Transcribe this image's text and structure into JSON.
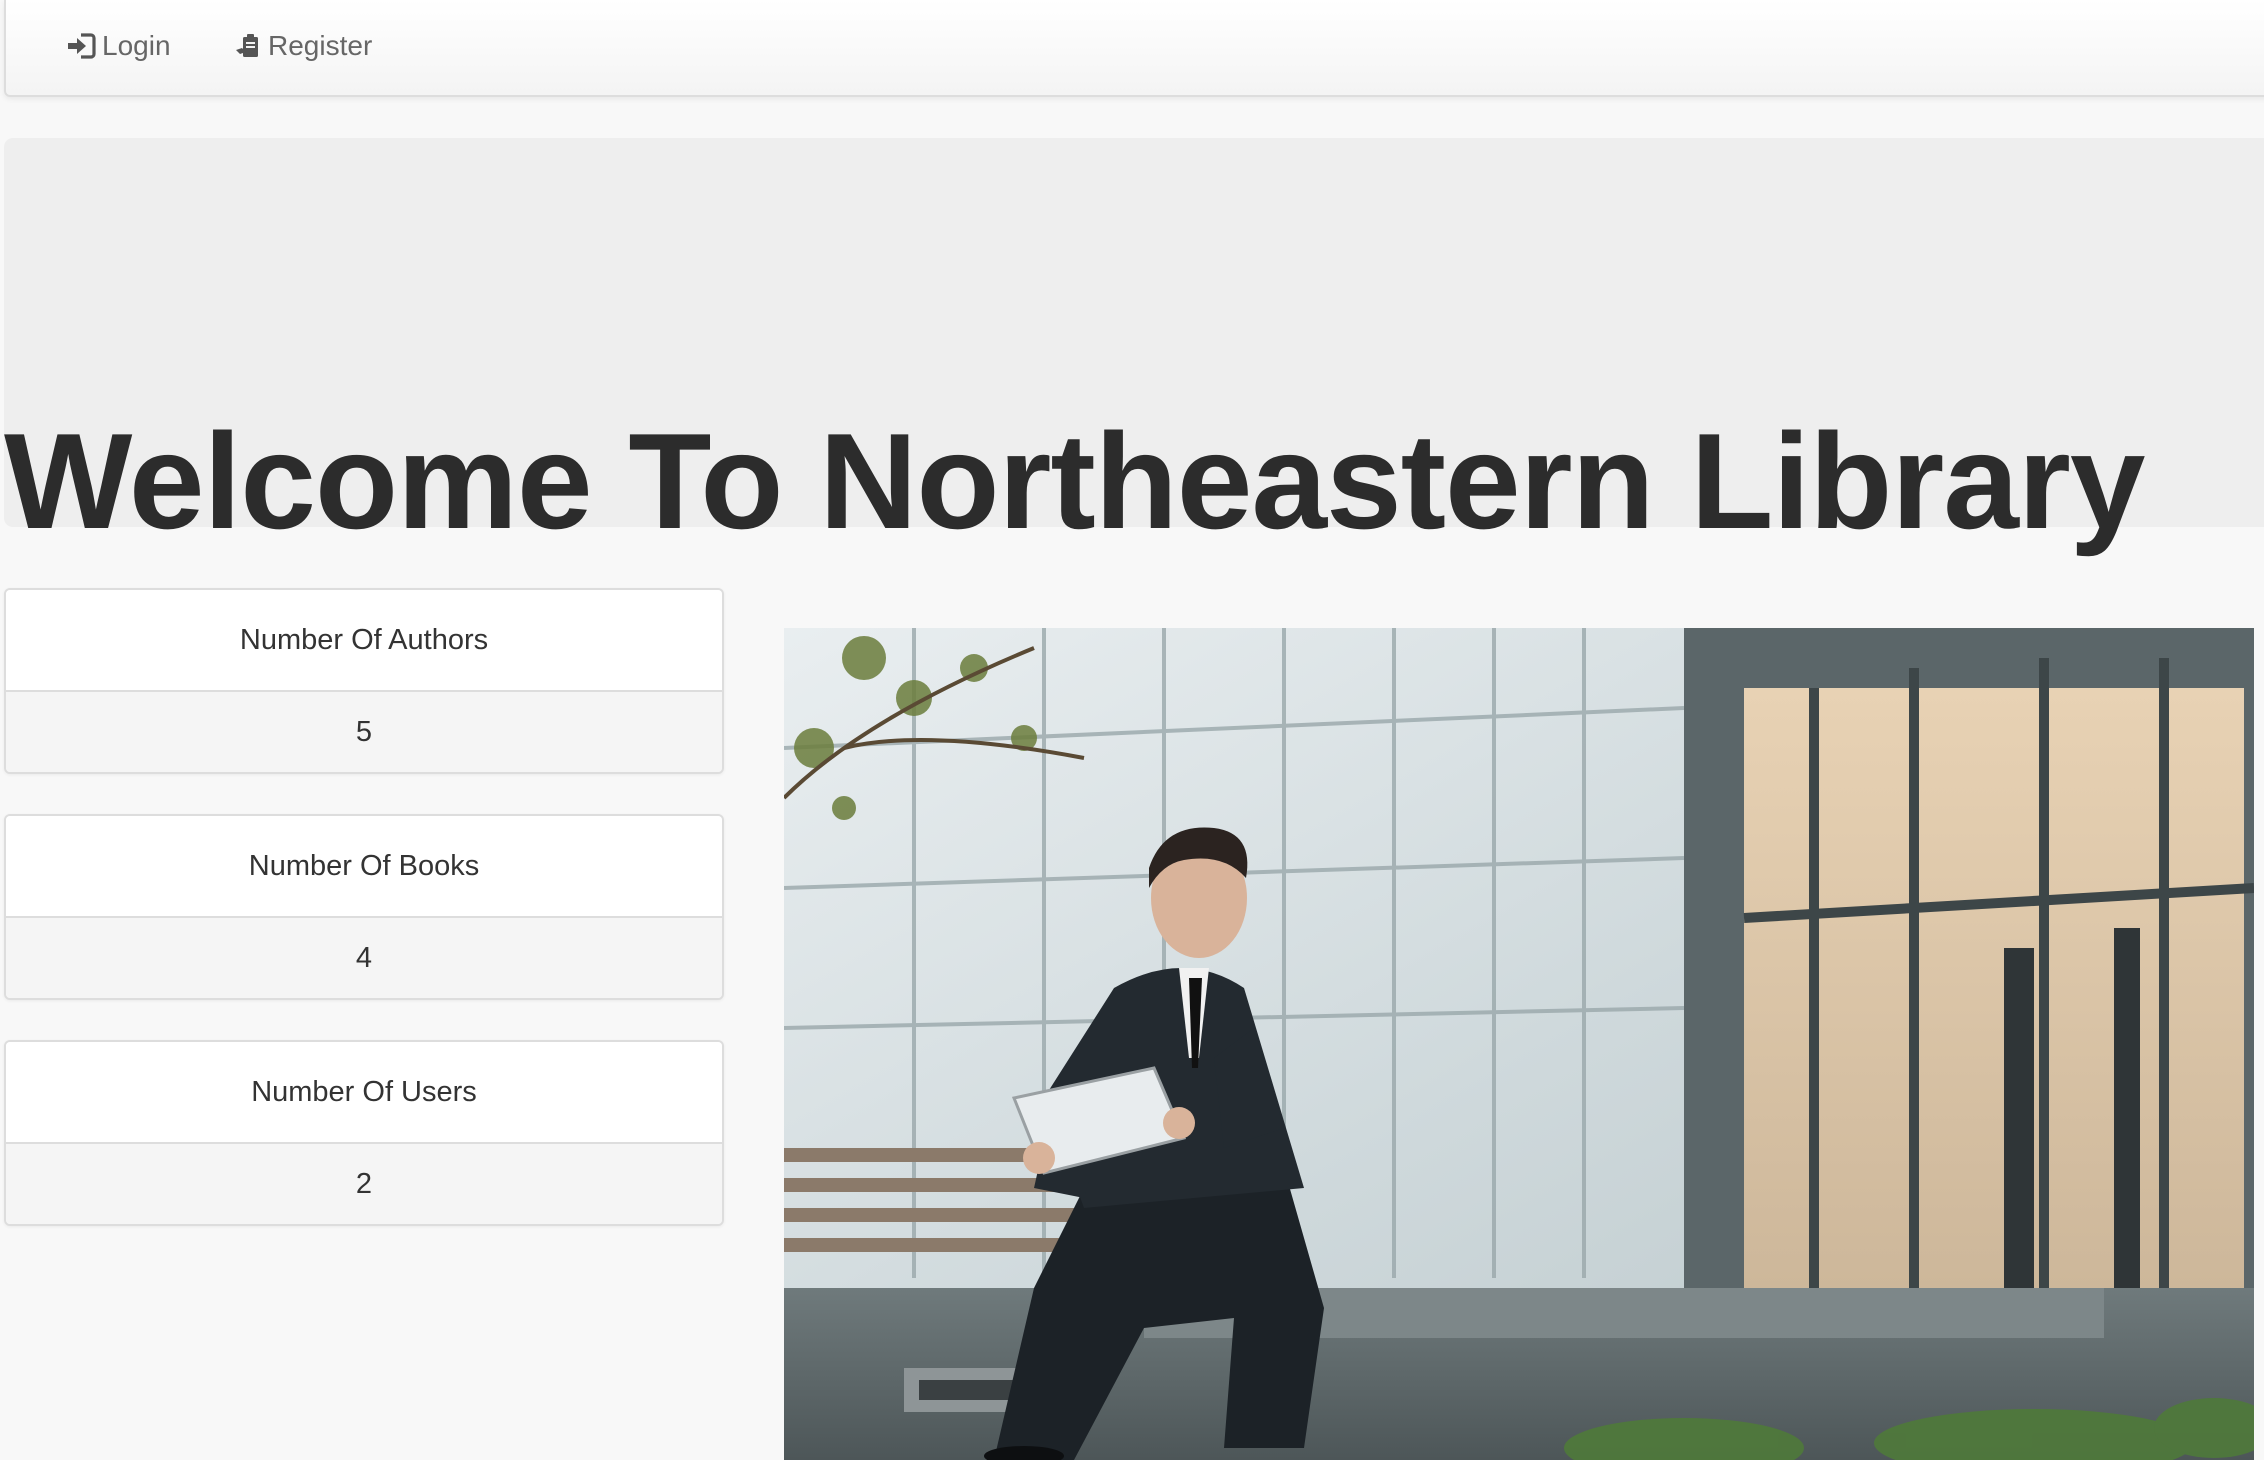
{
  "nav": {
    "login_label": "Login",
    "register_label": "Register",
    "login_icon": "sign-in-icon",
    "register_icon": "register-icon"
  },
  "hero": {
    "title": "Welcome To Northeastern Library"
  },
  "stats": [
    {
      "label": "Number Of Authors",
      "value": "5"
    },
    {
      "label": "Number Of Books",
      "value": "4"
    },
    {
      "label": "Number Of Users",
      "value": "2"
    }
  ],
  "photo": {
    "subject": "man-in-suit-reading-tablet-icon"
  },
  "colors": {
    "page_bg": "#f8f8f8",
    "jumbotron_bg": "#eeeeee",
    "text": "#333333",
    "nav_text": "#666666",
    "border": "#dddddd"
  }
}
